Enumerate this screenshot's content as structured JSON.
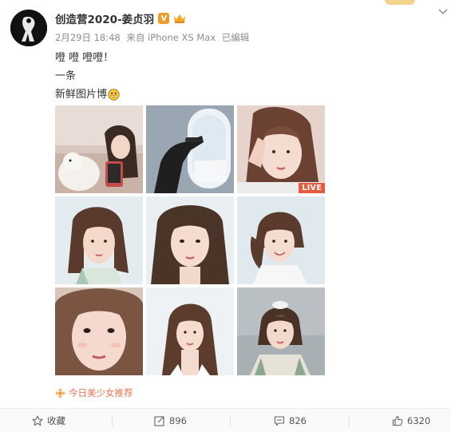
{
  "post": {
    "username": "创造营2020-姜贞羽",
    "verified_badge": "V",
    "date": "2月29日 18:48",
    "source": "来自 iPhone XS Max",
    "edited": "已编辑",
    "lines": [
      "噔 噔 噔噔！",
      "一条",
      "新鲜图片博"
    ],
    "emoji": "grinning-face-emoji",
    "live_label": "LIVE",
    "topic": "今日美少女推荐"
  },
  "actions": {
    "favorite_label": "收藏",
    "share_count": "896",
    "comment_count": "826",
    "like_count": "6320"
  },
  "colors": {
    "link_orange": "#eb7350",
    "badge_orange": "#f09a2a",
    "live_red": "#e85b3e",
    "meta_gray": "#8d8d8d"
  }
}
